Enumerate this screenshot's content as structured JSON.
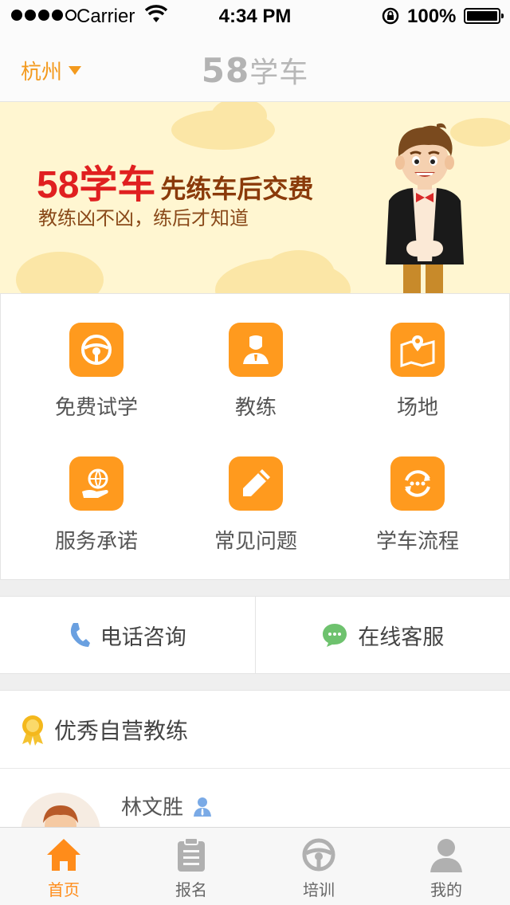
{
  "status_bar": {
    "carrier": "Carrier",
    "time": "4:34 PM",
    "battery": "100%"
  },
  "nav": {
    "city": "杭州",
    "title_number": "58",
    "title_text": "学车"
  },
  "banner": {
    "brand": "58学车",
    "slogan": "先练车后交费",
    "subtitle": "教练凶不凶，练后才知道"
  },
  "menu": [
    {
      "label": "免费试学",
      "icon": "steering-wheel-icon"
    },
    {
      "label": "教练",
      "icon": "coach-icon"
    },
    {
      "label": "场地",
      "icon": "map-pin-icon"
    },
    {
      "label": "服务承诺",
      "icon": "globe-hand-icon"
    },
    {
      "label": "常见问题",
      "icon": "pencil-icon"
    },
    {
      "label": "学车流程",
      "icon": "cycle-icon"
    }
  ],
  "contact": {
    "phone_label": "电话咨询",
    "chat_label": "在线客服"
  },
  "coaches": {
    "section_title": "优秀自营教练",
    "items": [
      {
        "name": "林文胜"
      }
    ]
  },
  "tabs": [
    {
      "label": "首页",
      "icon": "home-icon",
      "active": true
    },
    {
      "label": "报名",
      "icon": "clipboard-icon",
      "active": false
    },
    {
      "label": "培训",
      "icon": "steering-wheel-icon",
      "active": false
    },
    {
      "label": "我的",
      "icon": "user-icon",
      "active": false
    }
  ],
  "colors": {
    "accent": "#ff9a1e",
    "brand_red": "#e02020",
    "banner_bg": "#fff6d1"
  }
}
